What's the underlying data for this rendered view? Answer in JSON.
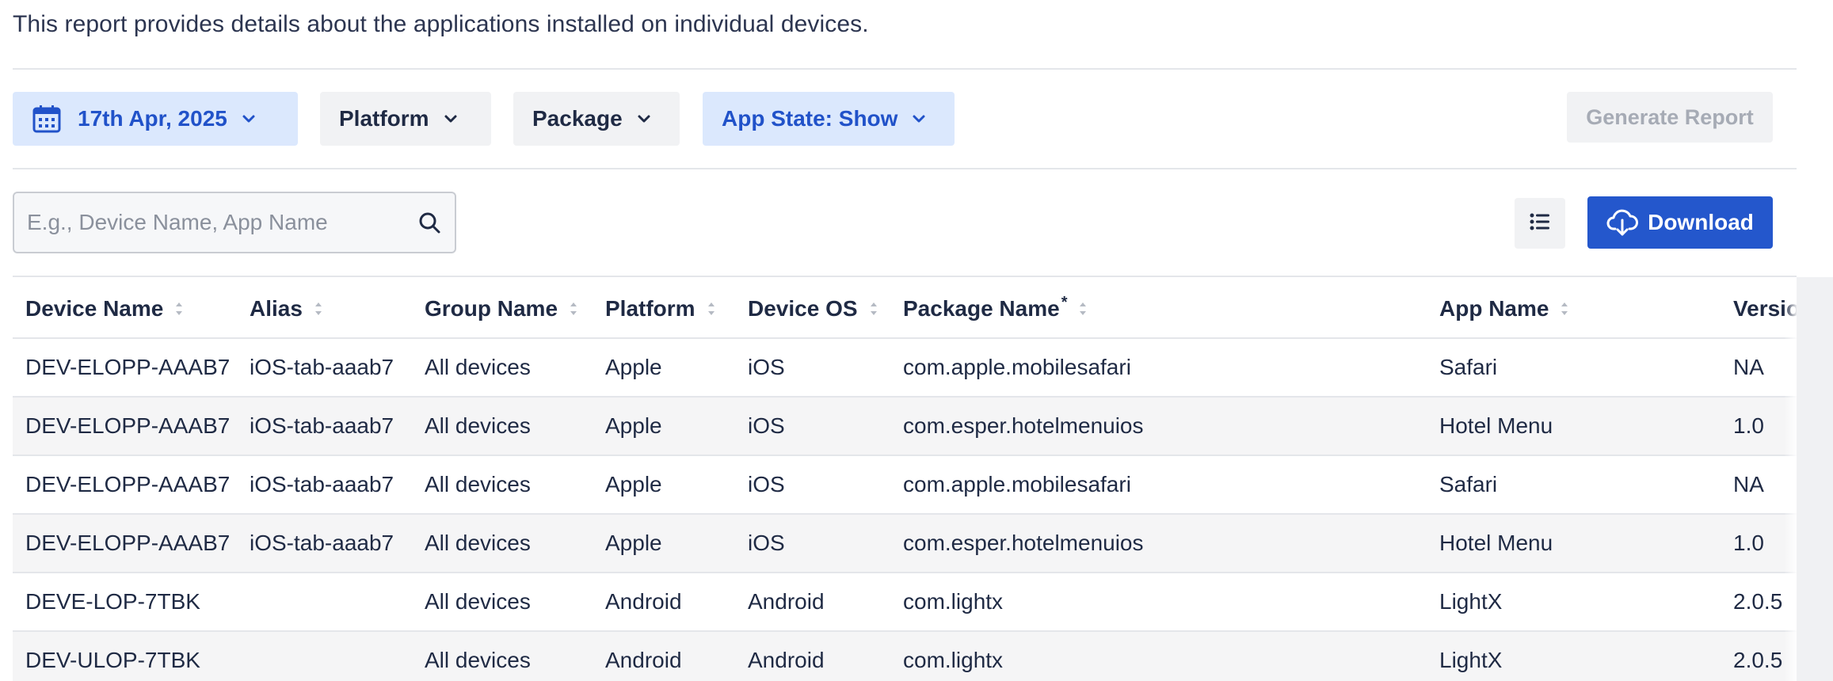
{
  "description": "This report provides details about the applications installed on individual devices.",
  "filters": {
    "date": "17th Apr, 2025",
    "platform": "Platform",
    "package": "Package",
    "app_state": "App State: Show"
  },
  "generate_label": "Generate Report",
  "search": {
    "placeholder": "E.g., Device Name, App Name",
    "value": ""
  },
  "download_label": "Download",
  "colors": {
    "accent": "#2457cc",
    "selected_bg": "#dbe8fd",
    "selected_text": "#2152c9"
  },
  "icons": {
    "date": "calendar-icon",
    "dropdown": "chevron-down-icon",
    "search": "search-icon",
    "columns": "list-icon",
    "download": "cloud-download-icon",
    "sort": "sort-icon"
  },
  "table": {
    "headers": {
      "device": "Device Name",
      "alias": "Alias",
      "group": "Group Name",
      "platform": "Platform",
      "os": "Device OS",
      "package": "Package Name",
      "package_mark": "*",
      "app": "App Name",
      "version": "Versio"
    },
    "rows": [
      {
        "device": "DEV-ELOPP-AAAB7",
        "alias": "iOS-tab-aaab7",
        "group": "All devices",
        "platform": "Apple",
        "os": "iOS",
        "package": "com.apple.mobilesafari",
        "app": "Safari",
        "version": "NA"
      },
      {
        "device": "DEV-ELOPP-AAAB7",
        "alias": "iOS-tab-aaab7",
        "group": "All devices",
        "platform": "Apple",
        "os": "iOS",
        "package": "com.esper.hotelmenuios",
        "app": "Hotel Menu",
        "version": "1.0"
      },
      {
        "device": "DEV-ELOPP-AAAB7",
        "alias": "iOS-tab-aaab7",
        "group": "All devices",
        "platform": "Apple",
        "os": "iOS",
        "package": "com.apple.mobilesafari",
        "app": "Safari",
        "version": "NA"
      },
      {
        "device": "DEV-ELOPP-AAAB7",
        "alias": "iOS-tab-aaab7",
        "group": "All devices",
        "platform": "Apple",
        "os": "iOS",
        "package": "com.esper.hotelmenuios",
        "app": "Hotel Menu",
        "version": "1.0"
      },
      {
        "device": "DEVE-LOP-7TBK",
        "alias": "",
        "group": "All devices",
        "platform": "Android",
        "os": "Android",
        "package": "com.lightx",
        "app": "LightX",
        "version": "2.0.5"
      },
      {
        "device": "DEV-ULOP-7TBK",
        "alias": "",
        "group": "All devices",
        "platform": "Android",
        "os": "Android",
        "package": "com.lightx",
        "app": "LightX",
        "version": "2.0.5"
      }
    ]
  }
}
